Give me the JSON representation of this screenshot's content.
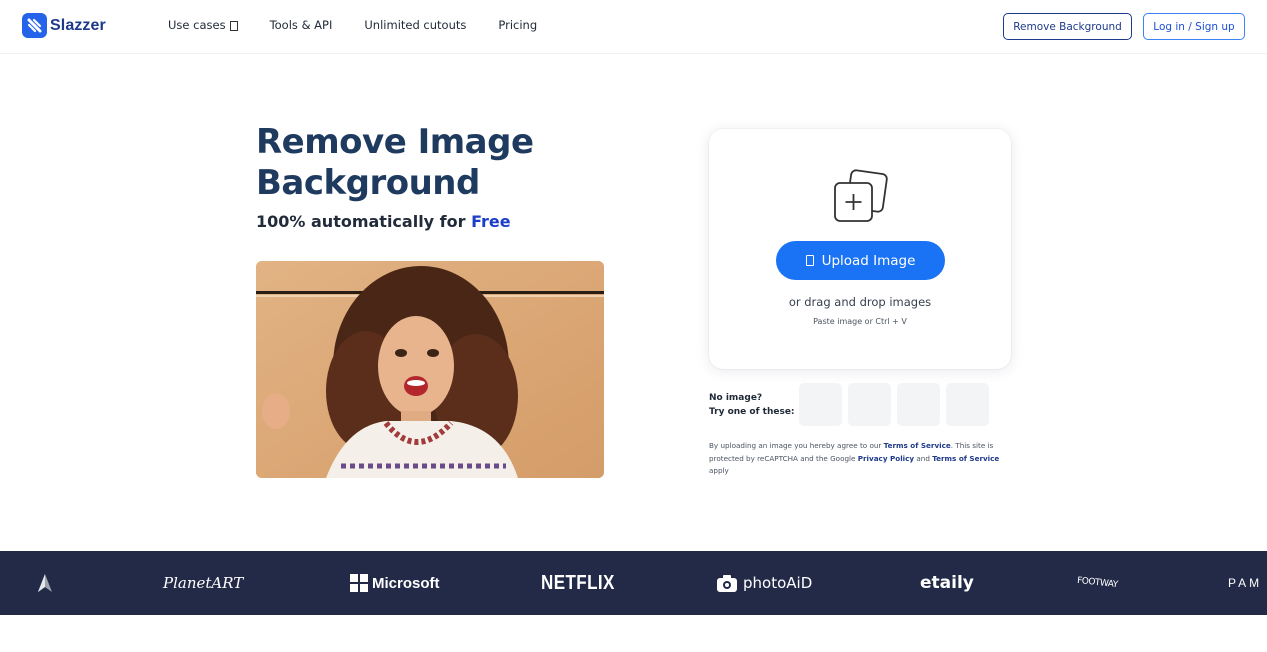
{
  "header": {
    "logo_text": "Slazzer",
    "nav": [
      {
        "label": "Use cases"
      },
      {
        "label": "Tools & API"
      },
      {
        "label": "Unlimited cutouts"
      },
      {
        "label": "Pricing"
      }
    ],
    "remove_bg_label": "Remove Background",
    "login_label": "Log in / Sign up"
  },
  "hero": {
    "title": "Remove Image Background",
    "subtitle_prefix": "100% automatically for ",
    "subtitle_free": "Free"
  },
  "upload": {
    "button_label": "Upload Image",
    "drag_text": "or drag and drop images",
    "paste_text": "Paste image or Ctrl + V"
  },
  "samples": {
    "label_line1": "No image?",
    "label_line2": "Try one of these:"
  },
  "legal": {
    "part1": "By uploading an image you hereby agree to our ",
    "tos1": "Terms of Service",
    "part2": ". This site is protected by reCAPTCHA and the Google ",
    "privacy": "Privacy Policy",
    "part3": " and ",
    "tos2": "Terms of Service",
    "part4": " apply"
  },
  "brands": {
    "planetart": "PlanetART",
    "microsoft": "Microsoft",
    "netflix": "NETFLIX",
    "photoaid": "photoAiD",
    "etaily": "etaily",
    "footway": "FOOTWAY",
    "pam": "PAM"
  },
  "colors": {
    "accent": "#1a73f5",
    "title": "#1e3a5f",
    "strip": "#232a48"
  }
}
